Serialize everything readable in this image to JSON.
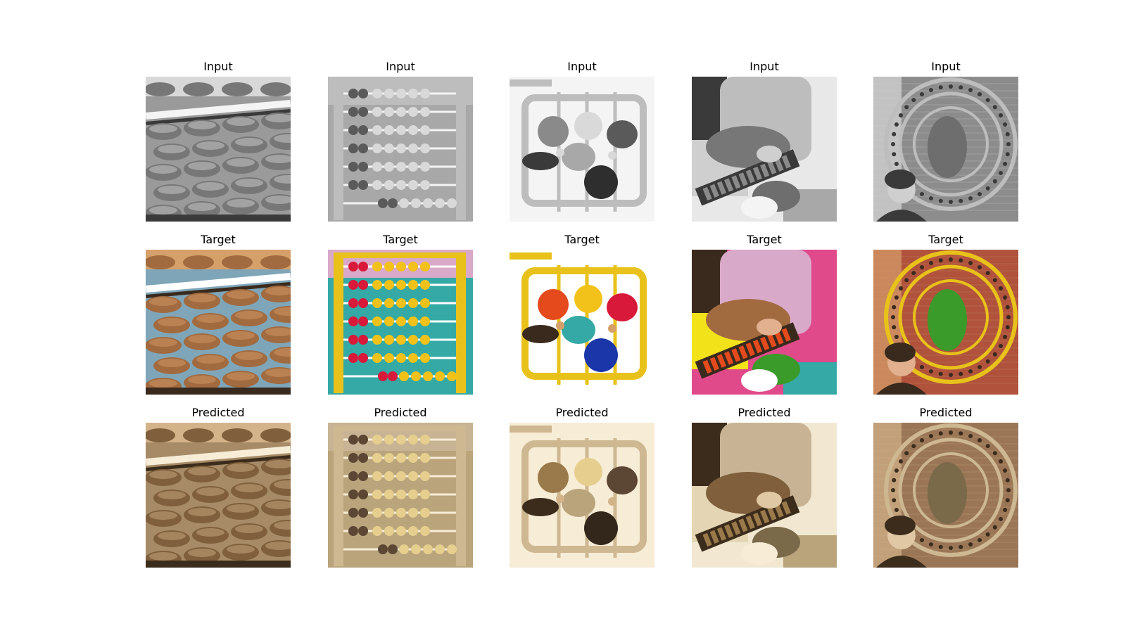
{
  "figure": {
    "rows": [
      {
        "label": "Input",
        "palette": "gray"
      },
      {
        "label": "Target",
        "palette": "color"
      },
      {
        "label": "Predicted",
        "palette": "sepia"
      }
    ],
    "columns": [
      {
        "subject": "soroban-closeup"
      },
      {
        "subject": "kids-abacus-frame"
      },
      {
        "subject": "gemstone-abacus"
      },
      {
        "subject": "child-holding-abacus"
      },
      {
        "subject": "circular-abacus-sculpture"
      }
    ]
  }
}
